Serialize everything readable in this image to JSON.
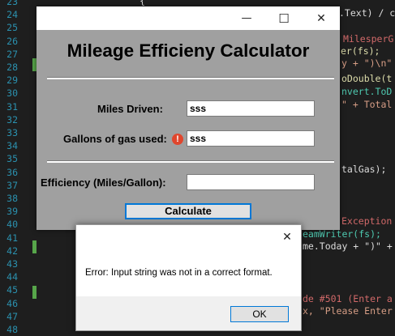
{
  "editor": {
    "line_numbers": [
      "23",
      "24",
      "25",
      "26",
      "27",
      "28",
      "29",
      "30",
      "31",
      "32",
      "33",
      "34",
      "35",
      "36",
      "37",
      "38",
      "39",
      "40",
      "41",
      "42",
      "43",
      "44",
      "45",
      "46",
      "47",
      "48"
    ],
    "fragments": [
      {
        "text": "{",
        "color": "#dcdcdc"
      },
      {
        "text": ".Text) / c",
        "color": "#dcdcdc"
      },
      {
        "text": "MilesperG",
        "color": "#d16969"
      },
      {
        "text": "er(fs);",
        "color": "#dcdcaa"
      },
      {
        "text": "y + \")\\n\"",
        "color": "#d69d85"
      },
      {
        "text": "oDouble(t",
        "color": "#dcdcaa"
      },
      {
        "text": "nvert.ToD",
        "color": "#4ec9b0"
      },
      {
        "text": "\" + Total",
        "color": "#d69d85"
      },
      {
        "text": "talGas);",
        "color": "#dcdcdc"
      },
      {
        "text": "Exception",
        "color": "#d16969"
      },
      {
        "text": "eamWriter(fs);",
        "color": "#4ec9b0"
      },
      {
        "text": "me.Today + \")\" +",
        "color": "#dcdcdc"
      },
      {
        "text": "de #501 (Enter a",
        "color": "#d16969"
      },
      {
        "text": "x, \"Please Enter",
        "color": "#d69d85"
      }
    ]
  },
  "window": {
    "controls": {
      "minimize": "—",
      "maximize": "☐",
      "close": "✕"
    },
    "title": "Mileage Efficieny Calculator",
    "miles_label": "Miles Driven:",
    "miles_value": "sss",
    "gallons_label": "Gallons of gas used:",
    "gallons_value": "sss",
    "error_icon": "!",
    "efficiency_label": "Efficiency (Miles/Gallon):",
    "efficiency_value": "",
    "calculate_label": "Calculate"
  },
  "dialog": {
    "close": "✕",
    "message": "Error: Input string was not in a correct format.",
    "ok_label": "OK"
  },
  "colors": {
    "accent": "#0078d7",
    "error": "#e0462d",
    "form_bg": "#a0a0a0",
    "editor_bg": "#1e1e1e"
  }
}
